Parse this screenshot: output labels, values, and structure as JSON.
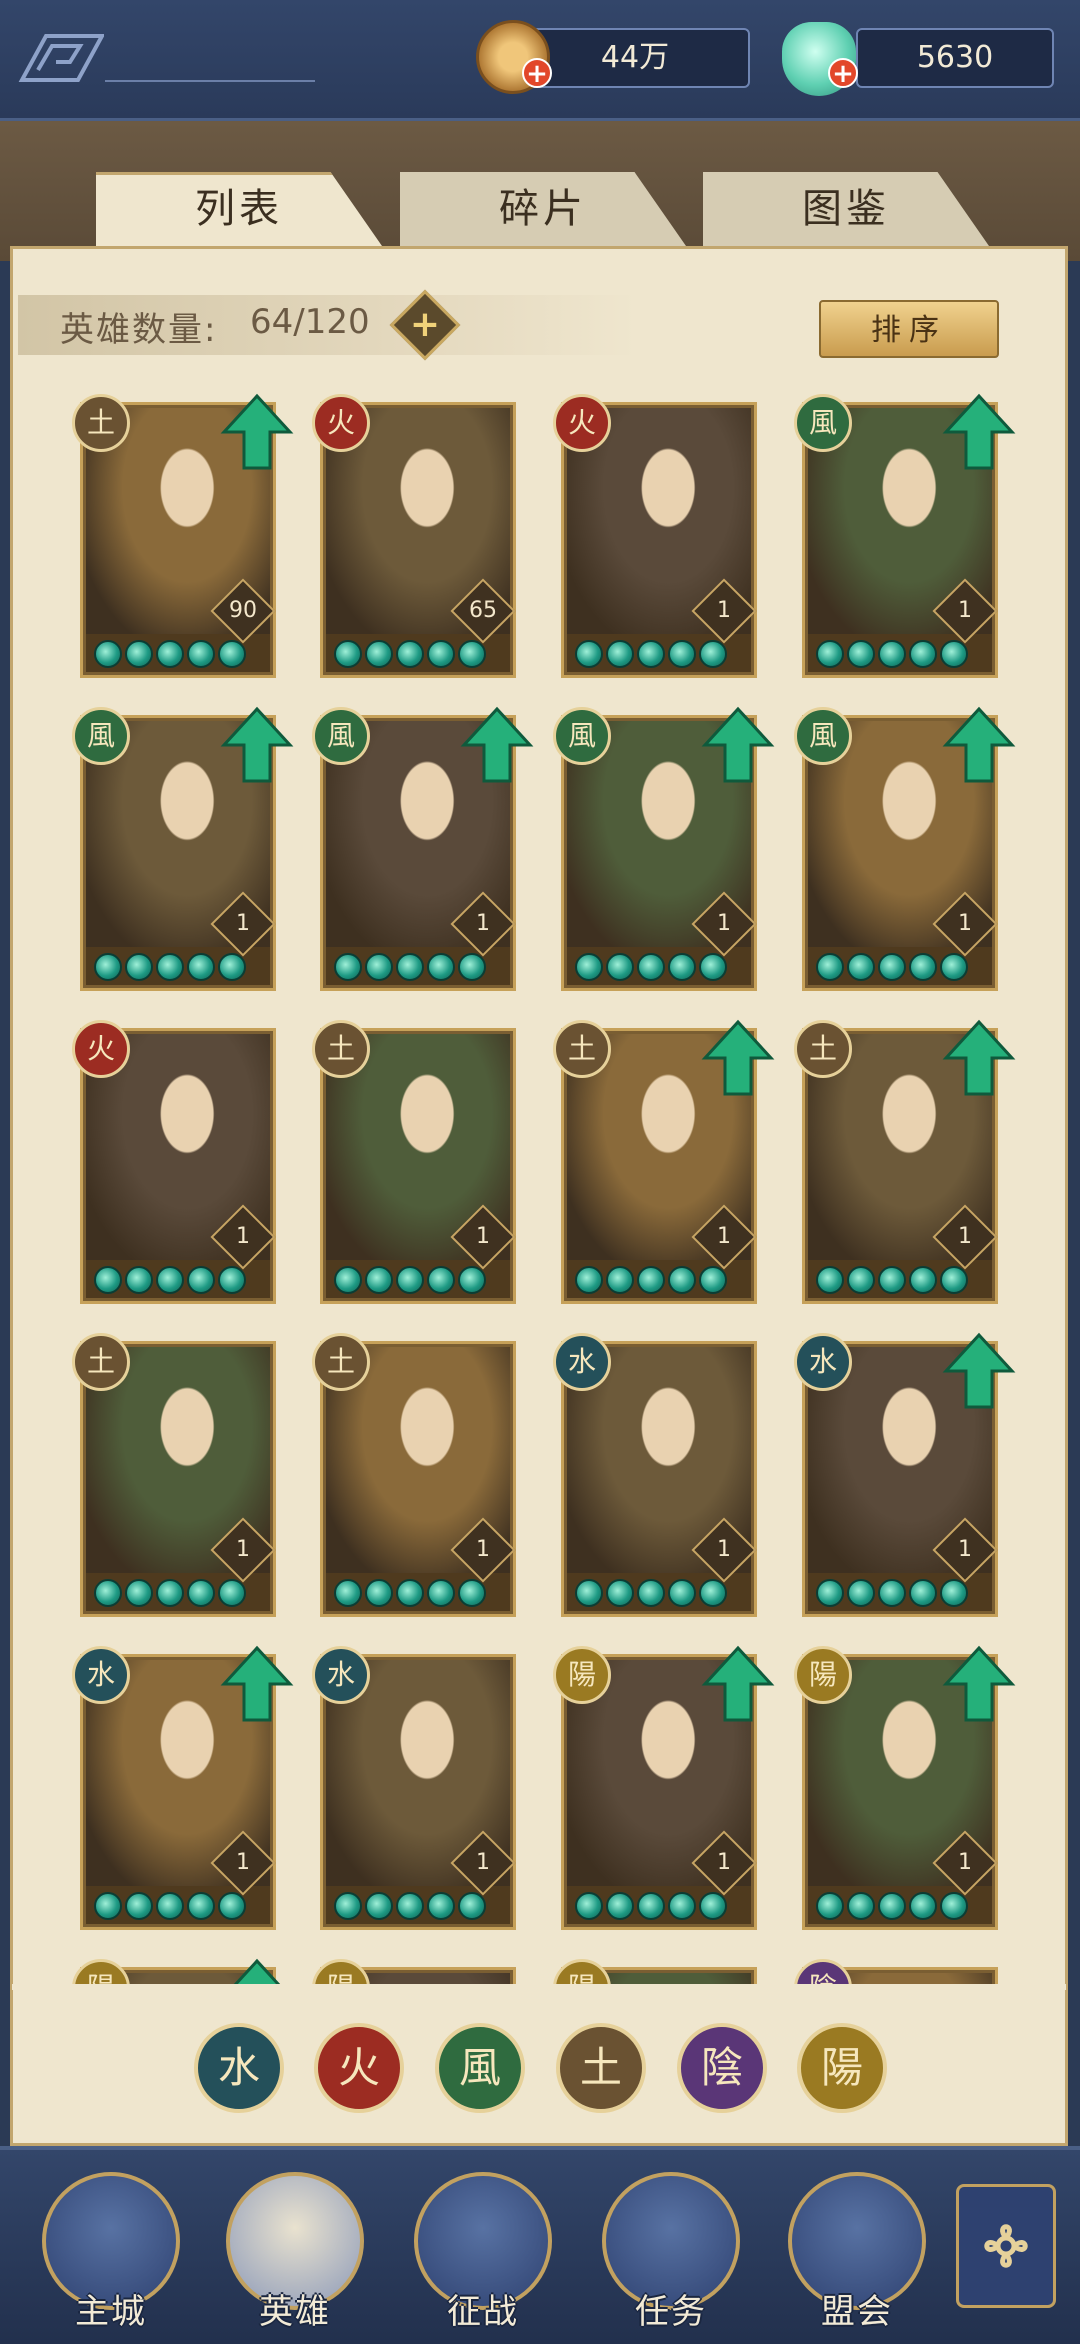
{
  "resources": {
    "coins": "44万",
    "jade": "5630"
  },
  "tabs": [
    "列表",
    "碎片",
    "图鉴"
  ],
  "hero_count": {
    "label": "英雄数量:",
    "value": "64/120"
  },
  "sort_label": "排序",
  "heroes": [
    {
      "element": "土",
      "level": "90",
      "upgrade": true
    },
    {
      "element": "火",
      "level": "65",
      "upgrade": false
    },
    {
      "element": "火",
      "level": "1",
      "upgrade": false
    },
    {
      "element": "風",
      "level": "1",
      "upgrade": true
    },
    {
      "element": "風",
      "level": "1",
      "upgrade": true
    },
    {
      "element": "風",
      "level": "1",
      "upgrade": true
    },
    {
      "element": "風",
      "level": "1",
      "upgrade": true
    },
    {
      "element": "風",
      "level": "1",
      "upgrade": true
    },
    {
      "element": "火",
      "level": "1",
      "upgrade": false
    },
    {
      "element": "土",
      "level": "1",
      "upgrade": false
    },
    {
      "element": "土",
      "level": "1",
      "upgrade": true
    },
    {
      "element": "土",
      "level": "1",
      "upgrade": true
    },
    {
      "element": "土",
      "level": "1",
      "upgrade": false
    },
    {
      "element": "土",
      "level": "1",
      "upgrade": false
    },
    {
      "element": "水",
      "level": "1",
      "upgrade": false
    },
    {
      "element": "水",
      "level": "1",
      "upgrade": true
    },
    {
      "element": "水",
      "level": "1",
      "upgrade": true
    },
    {
      "element": "水",
      "level": "1",
      "upgrade": false
    },
    {
      "element": "陽",
      "level": "1",
      "upgrade": true
    },
    {
      "element": "陽",
      "level": "1",
      "upgrade": true
    },
    {
      "element": "陽",
      "level": "",
      "upgrade": true
    },
    {
      "element": "陽",
      "level": "",
      "upgrade": false
    },
    {
      "element": "陽",
      "level": "",
      "upgrade": false
    },
    {
      "element": "陰",
      "level": "",
      "upgrade": false
    }
  ],
  "element_filters": [
    "水",
    "火",
    "風",
    "土",
    "陰",
    "陽"
  ],
  "nav": [
    "主城",
    "英雄",
    "征战",
    "任务",
    "盟会"
  ],
  "colors": {
    "fire": "#9c2c22",
    "earth": "#6a5232",
    "wind": "#2f6b3f",
    "water": "#24505a",
    "yin": "#5a3677",
    "yang": "#9a7a22",
    "upgrade": "#25b07a"
  }
}
